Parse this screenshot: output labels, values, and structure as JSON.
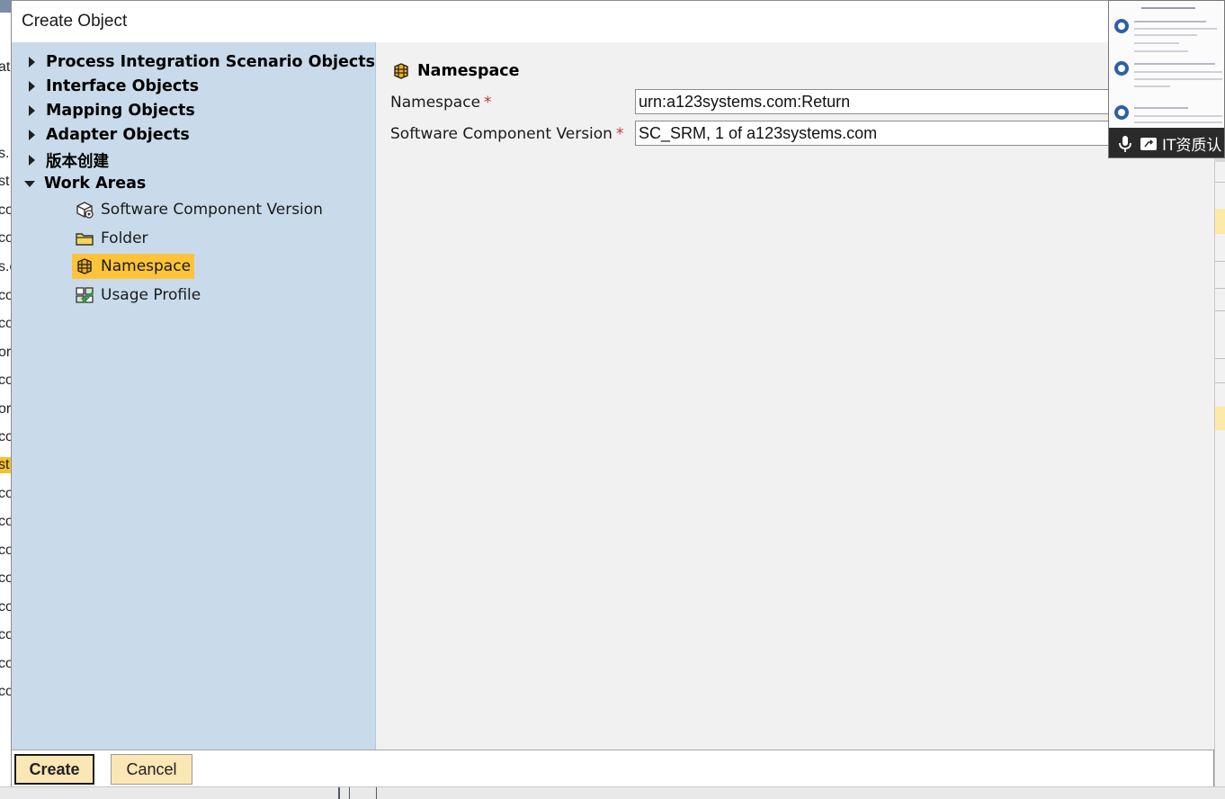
{
  "dialog": {
    "title": "Create Object"
  },
  "tree": {
    "groups": [
      {
        "label": "Process Integration Scenario Objects",
        "expanded": false
      },
      {
        "label": "Interface Objects",
        "expanded": false
      },
      {
        "label": "Mapping Objects",
        "expanded": false
      },
      {
        "label": "Adapter Objects",
        "expanded": false
      },
      {
        "label": "版本创建",
        "expanded": false
      },
      {
        "label": "Work Areas",
        "expanded": true
      }
    ],
    "work_area_items": [
      {
        "label": "Software Component Version",
        "icon": "software-component-icon"
      },
      {
        "label": "Folder",
        "icon": "folder-icon"
      },
      {
        "label": "Namespace",
        "icon": "namespace-icon",
        "selected": true
      },
      {
        "label": "Usage Profile",
        "icon": "usage-profile-icon"
      }
    ]
  },
  "form": {
    "section_title": "Namespace",
    "namespace_label": "Namespace",
    "namespace_value": "urn:a123systems.com:Return",
    "scv_label": "Software Component Version",
    "scv_value": "SC_SRM, 1 of a123systems.com",
    "required_marker": "*"
  },
  "buttons": {
    "create": "Create",
    "cancel": "Cancel"
  },
  "background_fragments": [
    "at",
    "s.",
    "st",
    "co",
    "co",
    "s.c",
    "co",
    "co",
    "or",
    "co",
    "or",
    "co",
    "st",
    "co",
    "co",
    "co",
    "co",
    "co",
    "co",
    "co",
    "co"
  ],
  "overlay": {
    "bar_text": "IT资质认"
  },
  "colors": {
    "left_pane": "#c9dbea",
    "selection": "#fdc33a",
    "button_bg": "#fbe7b4",
    "required": "#c0392b"
  }
}
